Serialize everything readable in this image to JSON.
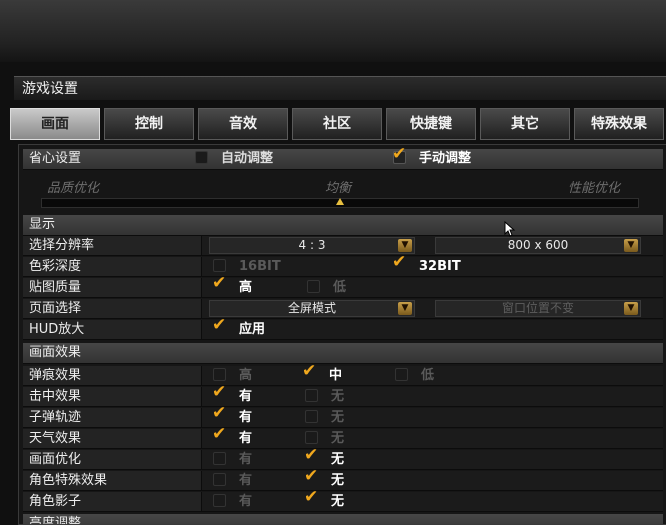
{
  "window": {
    "title": "游戏设置"
  },
  "tabs": [
    {
      "label": "画面",
      "active": true
    },
    {
      "label": "控制",
      "active": false
    },
    {
      "label": "音效",
      "active": false
    },
    {
      "label": "社区",
      "active": false
    },
    {
      "label": "快捷键",
      "active": false
    },
    {
      "label": "其它",
      "active": false
    },
    {
      "label": "特殊效果",
      "active": false
    }
  ],
  "easy": {
    "label": "省心设置",
    "auto": {
      "label": "自动调整",
      "checked": false
    },
    "manual": {
      "label": "手动调整",
      "checked": true
    }
  },
  "quality": {
    "left": "品质优化",
    "mid": "均衡",
    "right": "性能优化",
    "level": 0.5
  },
  "display": {
    "section": "显示",
    "resolution": {
      "label": "选择分辨率",
      "ratio": "4 : 3",
      "size": "800 x 600"
    },
    "color_depth": {
      "label": "色彩深度",
      "opt1": "16BIT",
      "opt2": "32BIT",
      "selected": "32BIT"
    },
    "texture": {
      "label": "贴图质量",
      "opt1": "高",
      "opt2": "低",
      "selected": "高"
    },
    "page": {
      "label": "页面选择",
      "mode": "全屏模式",
      "window_pos": "窗口位置不变"
    },
    "hud": {
      "label": "HUD放大",
      "opt1": "应用",
      "checked": true
    }
  },
  "effects": {
    "section": "画面效果",
    "bullet_hole": {
      "label": "弹痕效果",
      "opt1": "高",
      "opt2": "中",
      "opt3": "低",
      "selected": "中"
    },
    "hit": {
      "label": "击中效果",
      "opt1": "有",
      "opt2": "无",
      "selected": "有"
    },
    "bullet_trail": {
      "label": "子弹轨迹",
      "opt1": "有",
      "opt2": "无",
      "selected": "有"
    },
    "weather": {
      "label": "天气效果",
      "opt1": "有",
      "opt2": "无",
      "selected": "有"
    },
    "optimize": {
      "label": "画面优化",
      "opt1": "有",
      "opt2": "无",
      "selected": "无"
    },
    "char_special": {
      "label": "角色特殊效果",
      "opt1": "有",
      "opt2": "无",
      "selected": "无"
    },
    "char_shadow": {
      "label": "角色影子",
      "opt1": "有",
      "opt2": "无",
      "selected": "无"
    }
  },
  "next_section": "高度调整",
  "colors": {
    "accent": "#f0a81e",
    "active_tab": "#c9c9c9"
  }
}
